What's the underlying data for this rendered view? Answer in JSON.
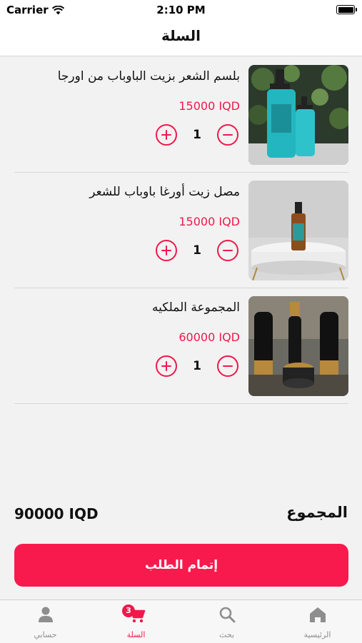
{
  "status_bar": {
    "carrier": "Carrier",
    "time": "2:10 PM"
  },
  "header": {
    "title": "السلة"
  },
  "cart": {
    "items": [
      {
        "name": "بلسم الشعر بزيت الباوباب من اورجا",
        "price": "15000 IQD",
        "quantity": "1"
      },
      {
        "name": "مصل زيت أورغا باوباب للشعر",
        "price": "15000 IQD",
        "quantity": "1"
      },
      {
        "name": "المجموعة الملكيه",
        "price": "60000 IQD",
        "quantity": "1"
      }
    ]
  },
  "summary": {
    "total_label": "المجموع",
    "total_value": "90000 IQD"
  },
  "checkout": {
    "label": "إتمام الطلب"
  },
  "tab_bar": {
    "tabs": [
      {
        "label": "حسابي",
        "icon": "person-icon"
      },
      {
        "label": "السلة",
        "icon": "cart-icon",
        "badge": "3",
        "active": true
      },
      {
        "label": "بحث",
        "icon": "search-icon"
      },
      {
        "label": "الرئيسية",
        "icon": "home-icon"
      }
    ]
  },
  "colors": {
    "accent": "#f0184a",
    "button": "#f91a4d",
    "background": "#f2f2f2"
  }
}
